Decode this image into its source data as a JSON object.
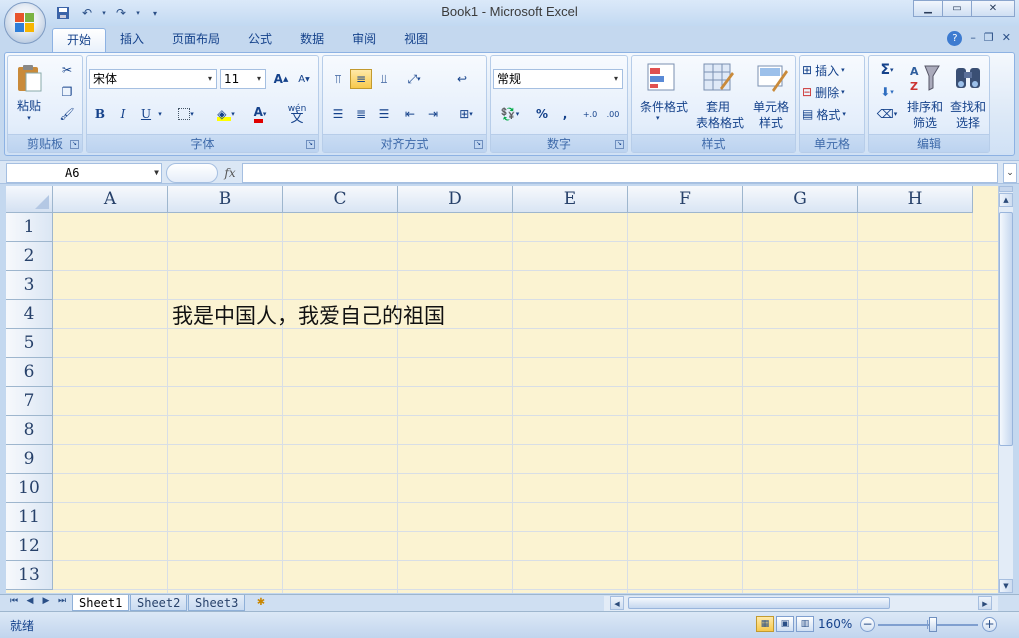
{
  "window": {
    "title": "Book1 - Microsoft Excel",
    "controls": {
      "minimize": "▁",
      "maximize": "▭",
      "close": "✕"
    }
  },
  "ribbon": {
    "tabs": [
      "开始",
      "插入",
      "页面布局",
      "公式",
      "数据",
      "审阅",
      "视图"
    ],
    "active_tab": "开始",
    "right_controls": {
      "help": "?",
      "min": "–",
      "restore": "❐",
      "close": "✕"
    },
    "groups": {
      "clipboard": {
        "label": "剪贴板",
        "paste": "粘贴"
      },
      "font": {
        "label": "字体",
        "font_name": "宋体",
        "font_size": "11",
        "bold": "B",
        "italic": "I",
        "underline": "U",
        "grow": "A",
        "shrink": "A",
        "wen": "wén"
      },
      "alignment": {
        "label": "对齐方式"
      },
      "number": {
        "label": "数字",
        "format": "常规",
        "percent": "%",
        "comma": ",",
        "inc_decimal": "+.0",
        "dec_decimal": ".00"
      },
      "styles": {
        "label": "样式",
        "conditional": "条件格式",
        "table_l1": "套用",
        "table_l2": "表格格式",
        "cell_l1": "单元格",
        "cell_l2": "样式"
      },
      "cells": {
        "label": "单元格",
        "insert": "插入",
        "delete": "删除",
        "format": "格式"
      },
      "editing": {
        "label": "编辑",
        "sigma": "Σ",
        "sort_l1": "排序和",
        "sort_l2": "筛选",
        "find_l1": "查找和",
        "find_l2": "选择"
      }
    }
  },
  "formula_bar": {
    "name_box": "A6",
    "fx": "fx",
    "formula": ""
  },
  "grid": {
    "columns": [
      "A",
      "B",
      "C",
      "D",
      "E",
      "F",
      "G",
      "H"
    ],
    "rows": [
      "1",
      "2",
      "3",
      "4",
      "5",
      "6",
      "7",
      "8",
      "9",
      "10",
      "11",
      "12",
      "13"
    ],
    "cells": {
      "B4": "我是中国人，我爱自己的祖国"
    }
  },
  "sheets": [
    "Sheet1",
    "Sheet2",
    "Sheet3"
  ],
  "active_sheet": "Sheet1",
  "status": {
    "text": "就绪",
    "zoom": "160%"
  },
  "colors": {
    "cell_background": "#fbf3d2",
    "ribbon_blue": "#15428b",
    "gridline": "#d8dee6"
  }
}
